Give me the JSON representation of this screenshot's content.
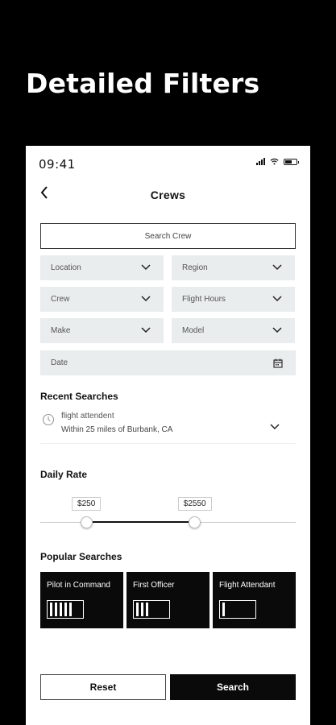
{
  "headline": "Detailed Filters",
  "status_bar": {
    "time": "09:41"
  },
  "nav": {
    "title": "Crews"
  },
  "search_crew": {
    "label": "Search Crew"
  },
  "filters": {
    "location": "Location",
    "region": "Region",
    "crew": "Crew",
    "flight_hours": "Flight Hours",
    "make": "Make",
    "model": "Model",
    "date": "Date"
  },
  "recent_searches": {
    "title": "Recent Searches",
    "items": [
      {
        "title": "flight attendent",
        "subtitle": "Within 25 miles of Burbank, CA"
      }
    ]
  },
  "daily_rate": {
    "title": "Daily Rate",
    "min_label": "$250",
    "max_label": "$2550",
    "min_position": 0.18,
    "max_position": 0.605
  },
  "popular_searches": {
    "title": "Popular Searches",
    "items": [
      {
        "label": "Pilot in Command",
        "bars": 5
      },
      {
        "label": "First Officer",
        "bars": 3
      },
      {
        "label": "Flight Attendant",
        "bars": 1
      }
    ]
  },
  "actions": {
    "reset": "Reset",
    "search": "Search"
  },
  "colors": {
    "background": "#000000",
    "surface": "#ffffff",
    "field": "#e9edee",
    "accent": "#0a0a0a"
  }
}
